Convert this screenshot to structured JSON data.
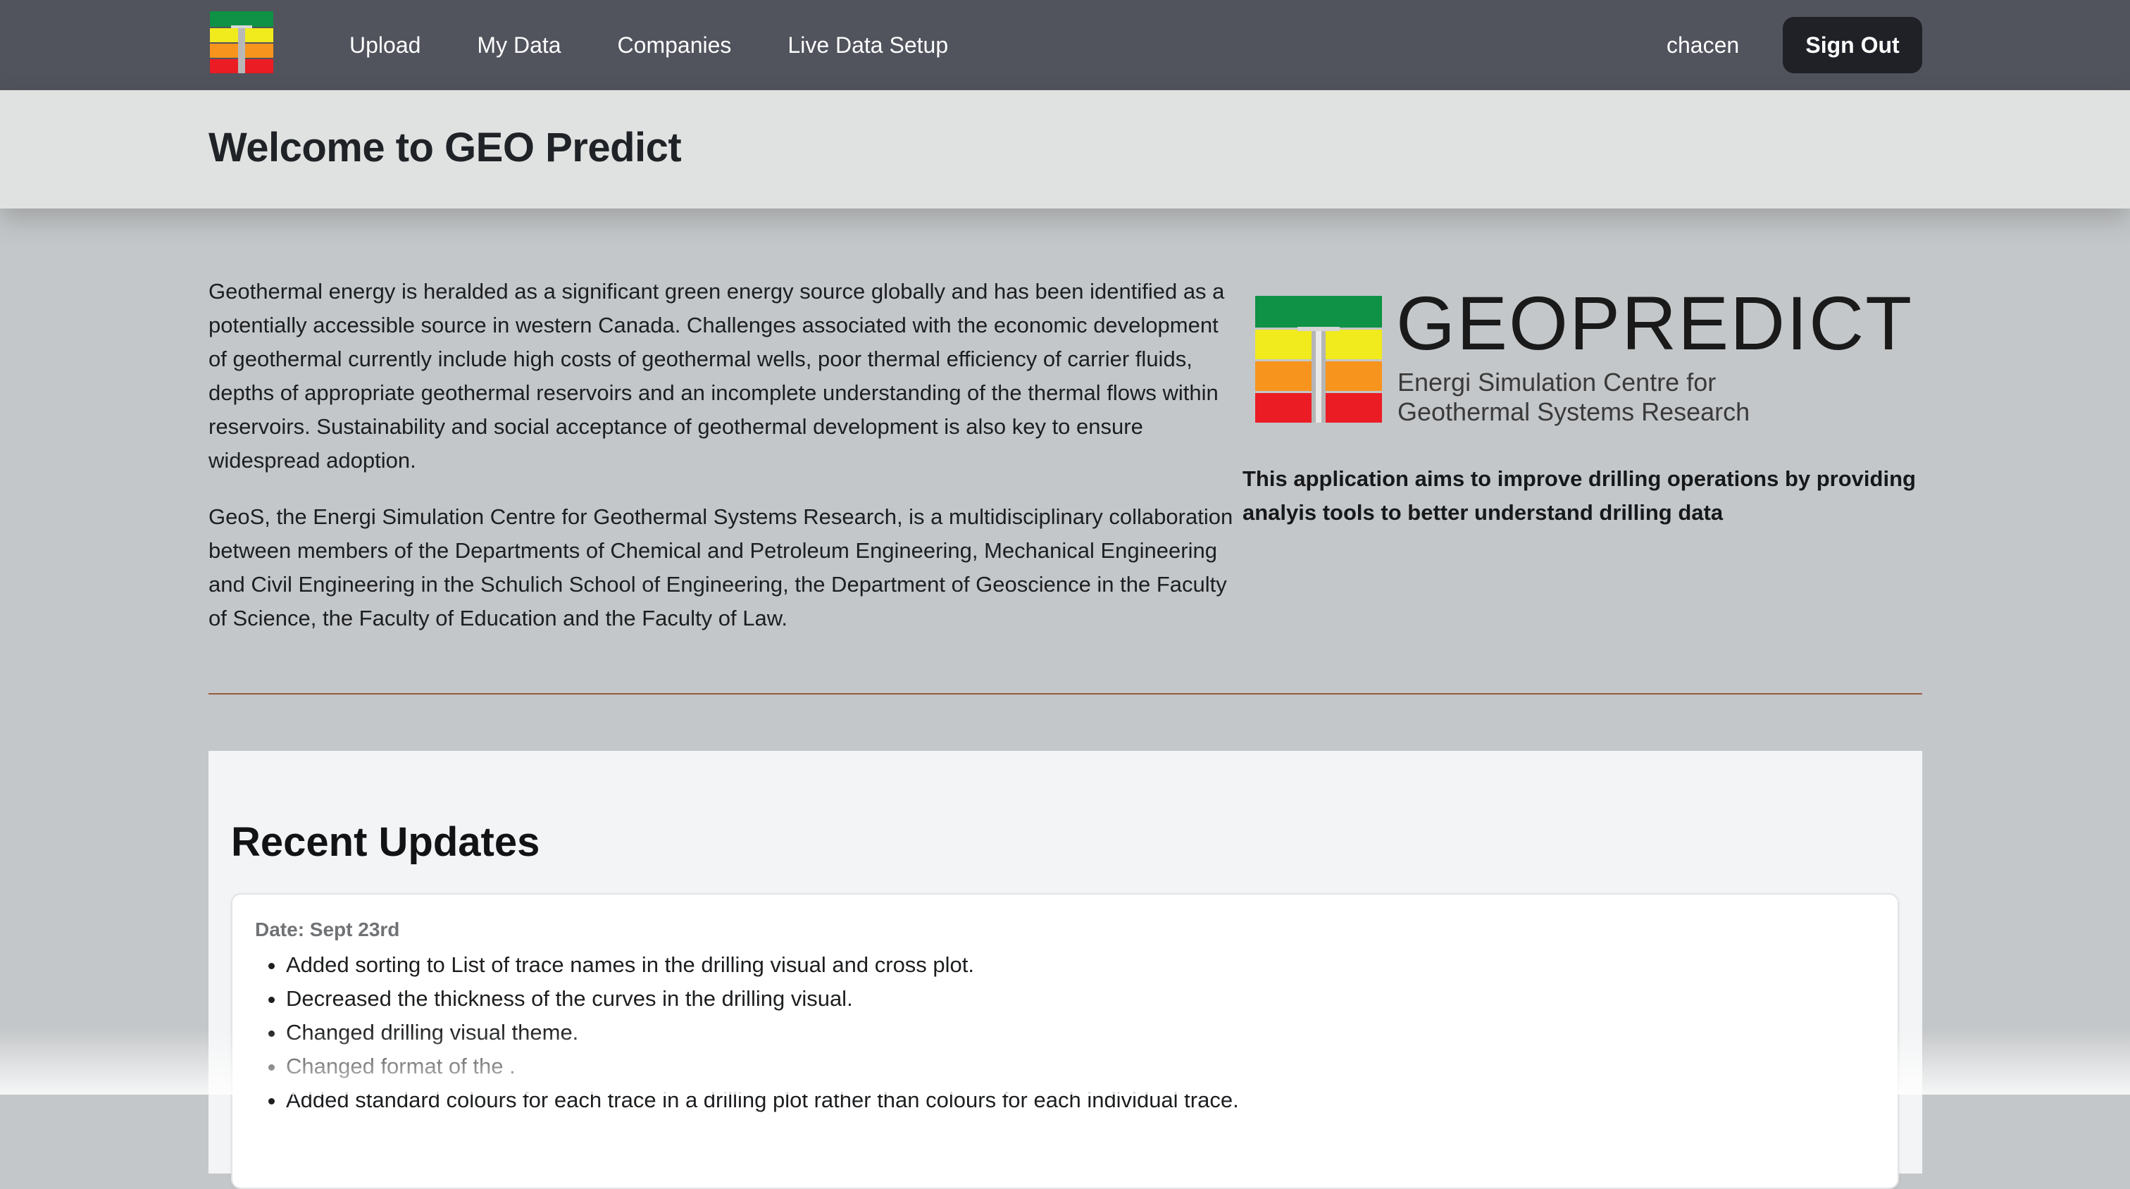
{
  "nav": {
    "logo_icon": "geopredict-logo-icon",
    "links": [
      "Upload",
      "My Data",
      "Companies",
      "Live Data Setup"
    ],
    "username": "chacen",
    "signout_label": "Sign Out",
    "background": "#51535d"
  },
  "welcome": {
    "title": "Welcome to GEO Predict"
  },
  "intro": {
    "paragraph1": "Geothermal energy is heralded as a significant green energy source globally and has been identified as a potentially accessible source in western Canada. Challenges associated with the economic development of geothermal currently include high costs of geothermal wells, poor thermal efficiency of carrier fluids, depths of appropriate geothermal reservoirs and an incomplete understanding of the thermal flows within reservoirs. Sustainability and social acceptance of geothermal development is also key to ensure widespread adoption.",
    "paragraph2": "GeoS, the Energi Simulation Centre for Geothermal Systems Research, is a multidisciplinary collaboration between members of the Departments of Chemical and Petroleum Engineering, Mechanical Engineering and Civil Engineering in the Schulich School of Engineering, the Department of Geoscience in the Faculty of Science, the Faculty of Education and the Faculty of Law."
  },
  "brand": {
    "name": "GEOPREDICT",
    "subtitle_line1": "Energi Simulation Centre for",
    "subtitle_line2": "Geothermal Systems Research",
    "tagline": "This application aims to improve drilling operations by providing analyis tools to better understand drilling data",
    "colors": {
      "green": "#0f9245",
      "yellow": "#f1ea1d",
      "orange": "#f7941d",
      "red": "#ec1c24"
    }
  },
  "updates": {
    "title": "Recent Updates",
    "entries": [
      {
        "date": "Date: Sept 23rd",
        "items": [
          "Added sorting to List of trace names in the drilling visual and cross plot.",
          "Decreased the thickness of the curves in the drilling visual.",
          "Changed drilling visual theme.",
          "Changed format of the .",
          "Added standard colours for each trace in a drilling plot rather than colours for each individual trace."
        ]
      }
    ]
  }
}
